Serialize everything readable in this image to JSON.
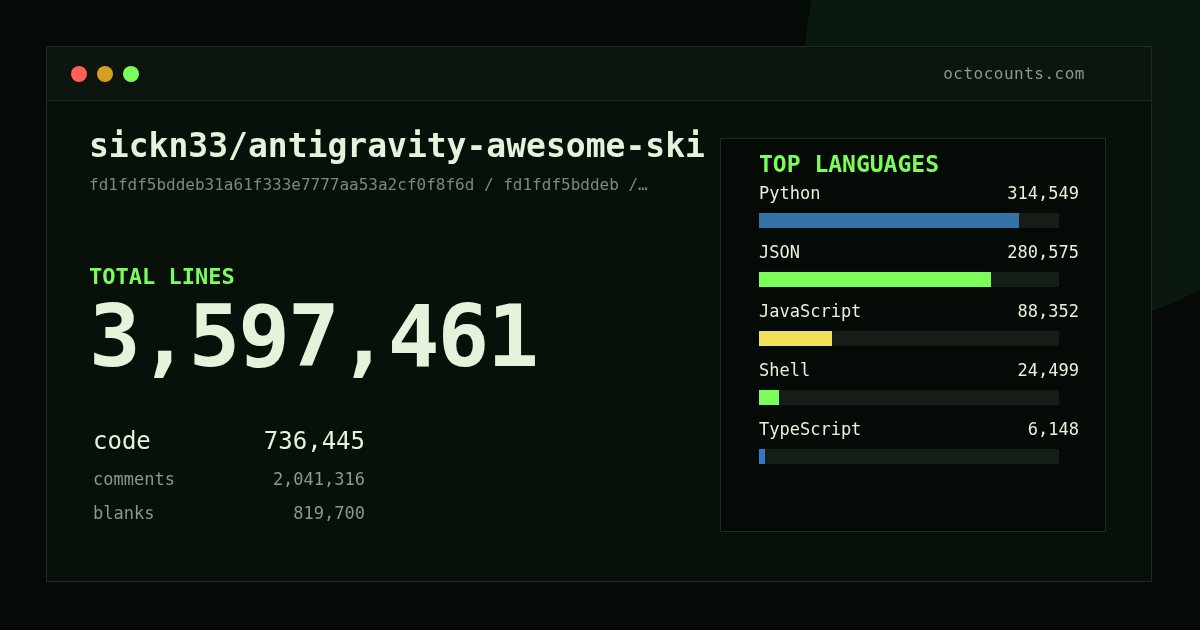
{
  "window": {
    "url": "octocounts.com"
  },
  "repo": {
    "name": "sickn33/antigravity-awesome-ski",
    "path": "fd1fdf5bddeb31a61f333e7777aa53a2cf0f8f6d / fd1fdf5bddeb /…"
  },
  "total": {
    "label": "TOTAL LINES",
    "value": "3,597,461"
  },
  "breakdown": [
    {
      "kind": "primary",
      "label": "code",
      "value": "736,445"
    },
    {
      "kind": "secondary",
      "label": "comments",
      "value": "2,041,316"
    },
    {
      "kind": "secondary",
      "label": "blanks",
      "value": "819,700"
    }
  ],
  "languages": {
    "title": "TOP LANGUAGES",
    "items": [
      {
        "name": "Python",
        "count": "314,549",
        "level": 0.867,
        "color": "#3572a5"
      },
      {
        "name": "JSON",
        "count": "280,575",
        "level": 0.773,
        "color": "#7afc5a"
      },
      {
        "name": "JavaScript",
        "count": "88,352",
        "level": 0.243,
        "color": "#f1e05a"
      },
      {
        "name": "Shell",
        "count": "24,499",
        "level": 0.067,
        "color": "#7afc5a"
      },
      {
        "name": "TypeScript",
        "count": "6,148",
        "level": 0.02,
        "color": "#3178c6"
      }
    ]
  }
}
